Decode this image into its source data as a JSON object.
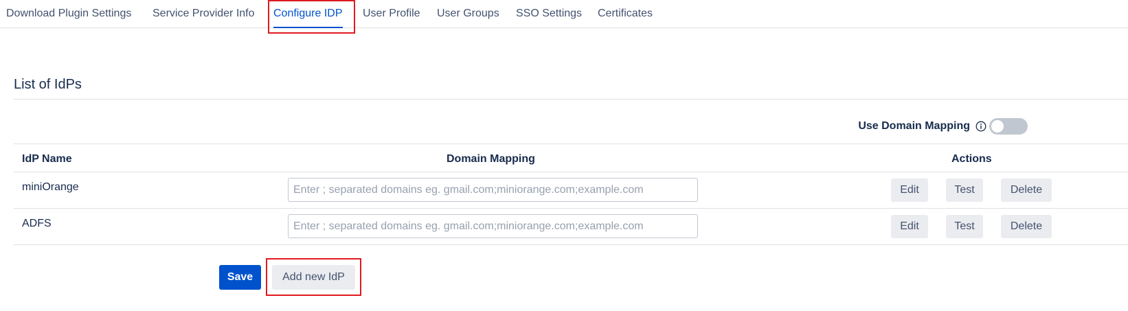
{
  "tabs": [
    {
      "label": "Download Plugin Settings",
      "active": false
    },
    {
      "label": "Service Provider Info",
      "active": false
    },
    {
      "label": "Configure IDP",
      "active": true
    },
    {
      "label": "User Profile",
      "active": false
    },
    {
      "label": "User Groups",
      "active": false
    },
    {
      "label": "SSO Settings",
      "active": false
    },
    {
      "label": "Certificates",
      "active": false
    }
  ],
  "section": {
    "title": "List of IdPs"
  },
  "domain_mapping_toggle": {
    "label": "Use Domain Mapping",
    "icon": "info-icon",
    "enabled": false
  },
  "table": {
    "headers": {
      "name": "IdP Name",
      "mapping": "Domain Mapping",
      "actions": "Actions"
    },
    "rows": [
      {
        "name": "miniOrange",
        "domain_value": "",
        "domain_placeholder": "Enter ; separated domains eg. gmail.com;miniorange.com;example.com"
      },
      {
        "name": "ADFS",
        "domain_value": "",
        "domain_placeholder": "Enter ; separated domains eg. gmail.com;miniorange.com;example.com"
      }
    ],
    "action_labels": {
      "edit": "Edit",
      "test": "Test",
      "delete": "Delete"
    }
  },
  "footer": {
    "save_label": "Save",
    "add_label": "Add new IdP"
  },
  "colors": {
    "accent": "#0052cc",
    "highlight": "#e0191f"
  }
}
